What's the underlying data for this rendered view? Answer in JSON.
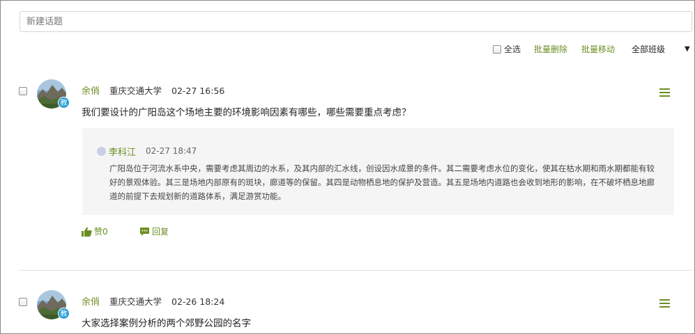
{
  "new_topic": {
    "placeholder": "新建话题"
  },
  "toolbar": {
    "select_all": "全选",
    "batch_delete": "批量删除",
    "batch_move": "批量移动",
    "class_filter": "全部班级"
  },
  "posts": [
    {
      "author": "余俏",
      "school": "重庆交通大学",
      "time": "02-27 16:56",
      "badge": "教",
      "content": "我们要设计的广阳岛这个场地主要的环境影响因素有哪些，哪些需要重点考虑？",
      "reply": {
        "author": "李科江",
        "time": "02-27 18:47",
        "text": "广阳岛位于河流水系中央，需要考虑其周边的水系，及其内部的汇水线，创设因水成景的条件。其二需要考虑水位的变化，使其在枯水期和雨水期都能有较好的景观体验。其三是场地内部原有的斑块，廊道等的保留。其四是动物栖息地的保护及营造。其五是场地内道路也会收到地形的影响，在不破坏栖息地廊道的前提下去规划新的道路体系，满足游赏功能。"
      },
      "like_label": "赞0",
      "reply_label": "回复"
    },
    {
      "author": "余俏",
      "school": "重庆交通大学",
      "time": "02-26 18:24",
      "badge": "教",
      "content": "大家选择案例分析的两个郊野公园的名字"
    }
  ],
  "colors": {
    "accent": "#6b8e23",
    "badge": "#2a9fd8",
    "reply_bg": "#f5f5f5"
  },
  "icons": [
    "thumbs-up-icon",
    "comment-icon",
    "menu-icon",
    "dropdown-caret-icon"
  ]
}
